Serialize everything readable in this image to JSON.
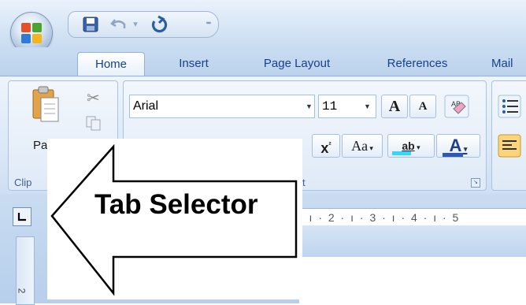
{
  "quick_access": {
    "icons": [
      "save-icon",
      "undo-icon",
      "redo-icon",
      "customize-qat-icon"
    ]
  },
  "tabs": [
    {
      "label": "Home",
      "active": true
    },
    {
      "label": "Insert"
    },
    {
      "label": "Page Layout"
    },
    {
      "label": "References"
    },
    {
      "label": "Mail"
    }
  ],
  "ribbon": {
    "clipboard": {
      "paste_label": "Pa",
      "group_label": "Clip"
    },
    "font": {
      "font_name": "Arial",
      "font_size": "11",
      "grow_font": "A",
      "shrink_font": "A",
      "superscript": "x",
      "superscript_mark": "²",
      "change_case": "Aa",
      "highlight_label": "ab",
      "font_color_label": "A",
      "group_label_fragment": "t"
    }
  },
  "ruler": {
    "ticks_text": "· ı · 2 · ı · 3 · ı · 4 · ı · 5",
    "vertical_number": "2"
  },
  "callout": {
    "text": "Tab Selector"
  },
  "colors": {
    "ribbon_text": "#15428b",
    "accent_blue": "#4a78c2",
    "highlight_cyan": "#33d6ff"
  }
}
